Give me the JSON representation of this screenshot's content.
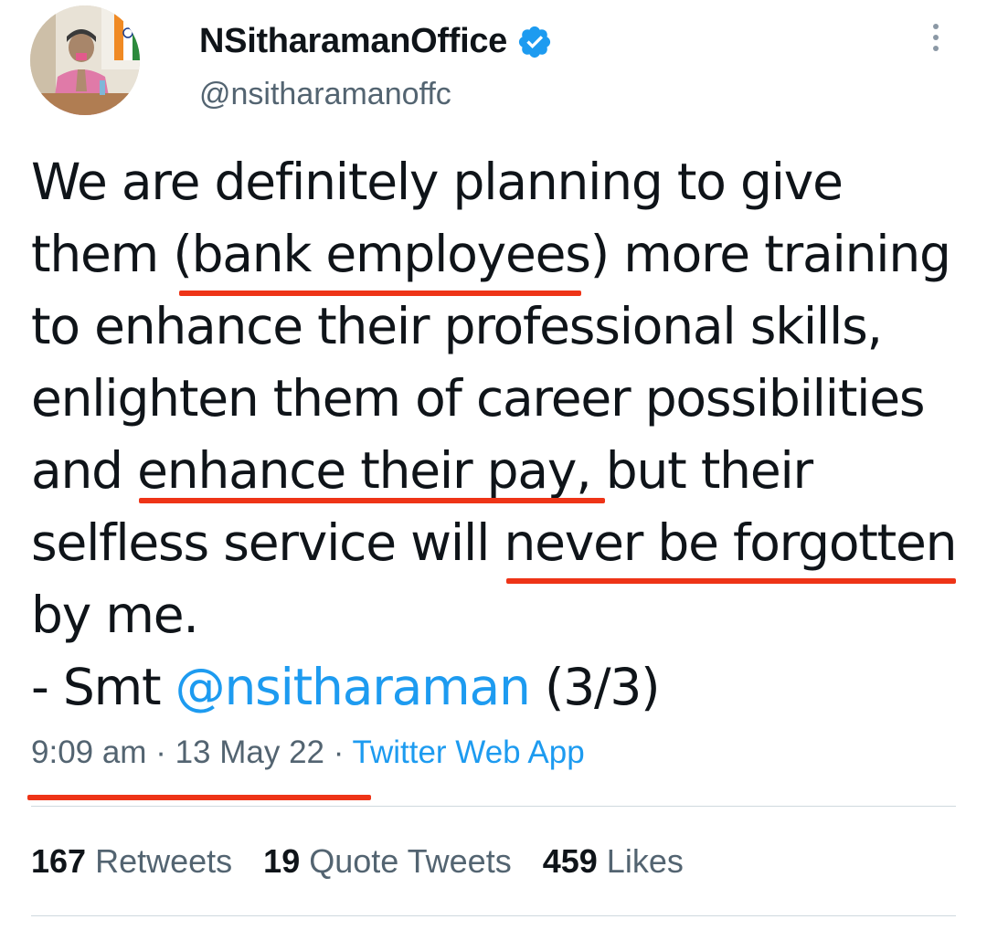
{
  "author": {
    "display_name": "NSitharamanOffice",
    "handle": "@nsitharamanoffc",
    "verified": true,
    "avatar_icon": "profile-photo",
    "verified_icon": "verified-badge-icon",
    "more_icon": "more-options-icon"
  },
  "tweet": {
    "lines": [
      "We are definitely planning to give",
      "them (bank employees) more training",
      "to enhance their professional skills,",
      "enlighten them of career possibilities",
      "and enhance their pay, but their",
      "selfless service will never be forgotten",
      "by me."
    ],
    "signature_prefix": "- Smt ",
    "signature_mention": "@nsitharaman",
    "signature_suffix": " (3/3)"
  },
  "meta": {
    "time": "9:09 am",
    "separator": " · ",
    "date": "13 May 22",
    "source": "Twitter Web App"
  },
  "stats": {
    "retweets_count": "167",
    "retweets_label": "Retweets",
    "quotes_count": "19",
    "quotes_label": "Quote Tweets",
    "likes_count": "459",
    "likes_label": "Likes"
  },
  "colors": {
    "accent": "#1d9bf0",
    "secondary_text": "#536471",
    "highlight_underline": "#ee3417"
  }
}
